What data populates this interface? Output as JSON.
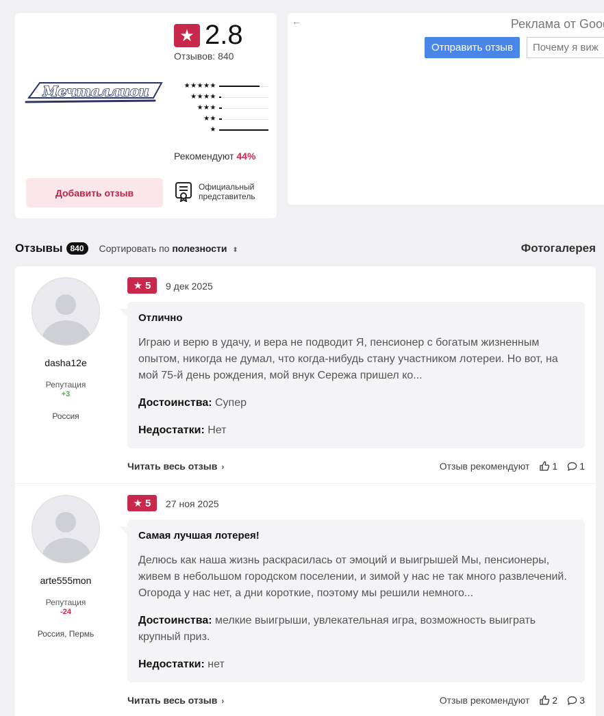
{
  "summary": {
    "logo_text": "Мечталлион",
    "rating": "2.8",
    "reviews_label": "Отзывов:",
    "reviews_count": "840",
    "distribution": [
      {
        "stars": "★★★★★",
        "fraction": 0.82
      },
      {
        "stars": "★★★★",
        "fraction": 0.03
      },
      {
        "stars": "★★★",
        "fraction": 0.06
      },
      {
        "stars": "★★",
        "fraction": 0.05
      },
      {
        "stars": "★",
        "fraction": 1.0
      }
    ],
    "recommend_label": "Рекомендуют",
    "recommend_pct": "44%",
    "add_review": "Добавить отзыв",
    "official_rep": "Официальный представитель"
  },
  "ad": {
    "back": "←",
    "label": "Реклама от Goog",
    "button": "Отправить отзыв",
    "input_placeholder": "Почему я виж"
  },
  "reviews_header": {
    "title": "Отзывы",
    "count": "840",
    "sort_prefix": "Сортировать по",
    "sort_value": "полезности",
    "gallery": "Фотогалерея"
  },
  "reviews": [
    {
      "username": "dasha12e",
      "reputation_label": "Репутация",
      "reputation": "+3",
      "location": "Россия",
      "stars": "5",
      "date": "9 дек 2025",
      "title": "Отлично",
      "text": "Играю и верю в удачу, и вера не подводит Я, пенсионер с богатым жизненным опытом, никогда не думал, что когда-нибудь стану участником лотереи. Но вот, на мой 75-й день рождения, мой внук Сережа пришел ко...",
      "pros_label": "Достоинства:",
      "pros": "Супер",
      "cons_label": "Недостатки:",
      "cons": "Нет",
      "read_more": "Читать весь отзыв",
      "recommend_label": "Отзыв рекомендуют",
      "likes": "1",
      "comments": "1"
    },
    {
      "username": "arte555mon",
      "reputation_label": "Репутация",
      "reputation": "-24",
      "location": "Россия, Пермь",
      "stars": "5",
      "date": "27 ноя 2025",
      "title": "Самая лучшая лотерея!",
      "text": "Делюсь как наша жизнь раскрасилась от эмоций и выигрышей Мы, пенсионеры, живем в небольшом городском поселении, и зимой у нас не так много развлечений. Огорода у нас нет, а дни короткие, поэтому мы решили немного...",
      "pros_label": "Достоинства:",
      "pros": "мелкие выигрыши, увлекательная игра, возможность выиграть крупный приз.",
      "cons_label": "Недостатки:",
      "cons": "нет",
      "read_more": "Читать весь отзыв",
      "recommend_label": "Отзыв рекомендуют",
      "likes": "2",
      "comments": "3"
    }
  ],
  "colors": {
    "accent": "#c8284c",
    "accent_light": "#fbe7ea",
    "ad_button": "#4a86e8",
    "rep_positive": "#4caf50",
    "rep_negative": "#c8284c"
  }
}
